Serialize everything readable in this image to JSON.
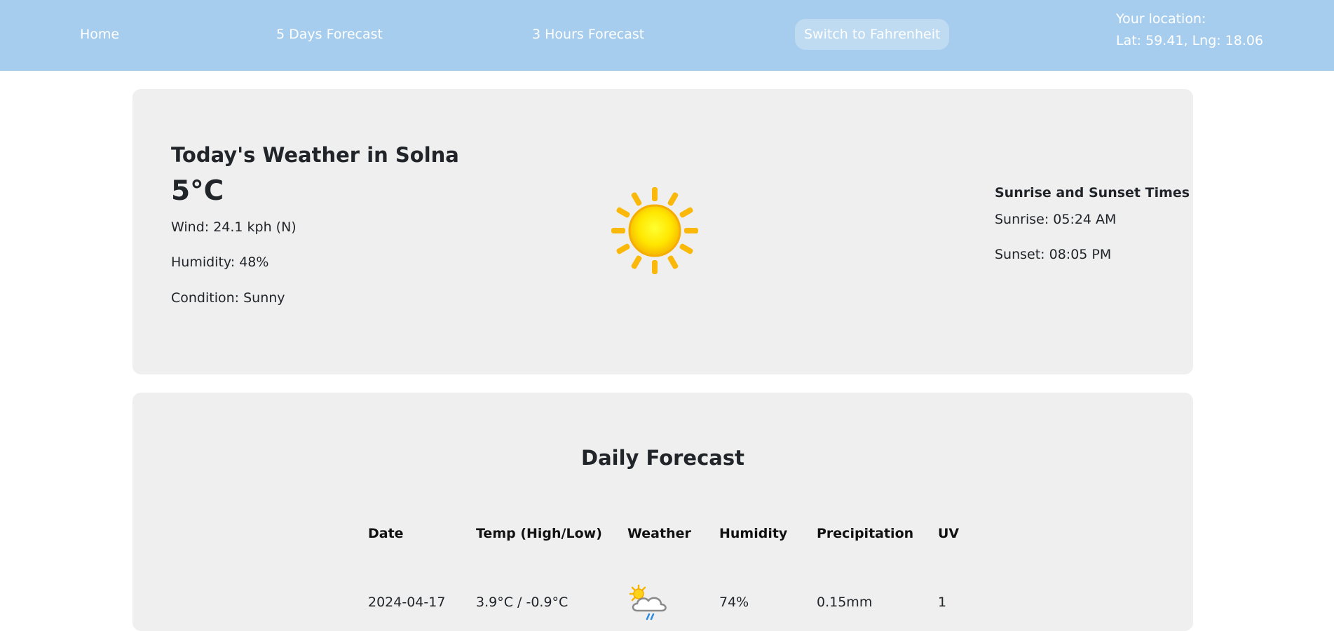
{
  "nav": {
    "home": "Home",
    "five_days": "5 Days Forecast",
    "three_hours": "3 Hours Forecast",
    "switch_unit": "Switch to Fahrenheit",
    "location_label": "Your location:",
    "location_coords": "Lat: 59.41, Lng: 18.06"
  },
  "today": {
    "title": "Today's Weather in Solna",
    "temperature": "5°C",
    "wind": "Wind: 24.1 kph (N)",
    "humidity": "Humidity: 48%",
    "condition": "Condition: Sunny",
    "icon": "sun-icon",
    "sun_heading": "Sunrise and Sunset Times",
    "sunrise": "Sunrise: 05:24 AM",
    "sunset": "Sunset: 08:05 PM"
  },
  "daily": {
    "title": "Daily Forecast",
    "headers": [
      "Date",
      "Temp (High/Low)",
      "Weather",
      "Humidity",
      "Precipitation",
      "UV"
    ],
    "rows": [
      {
        "date": "2024-04-17",
        "temp": "3.9°C / -0.9°C",
        "weather_icon": "sun-cloud-rain-icon",
        "humidity": "74%",
        "precipitation": "0.15mm",
        "uv": "1"
      }
    ]
  },
  "colors": {
    "navbar": "#a6cdee",
    "card": "#efefef",
    "sun": "#ffd400"
  }
}
